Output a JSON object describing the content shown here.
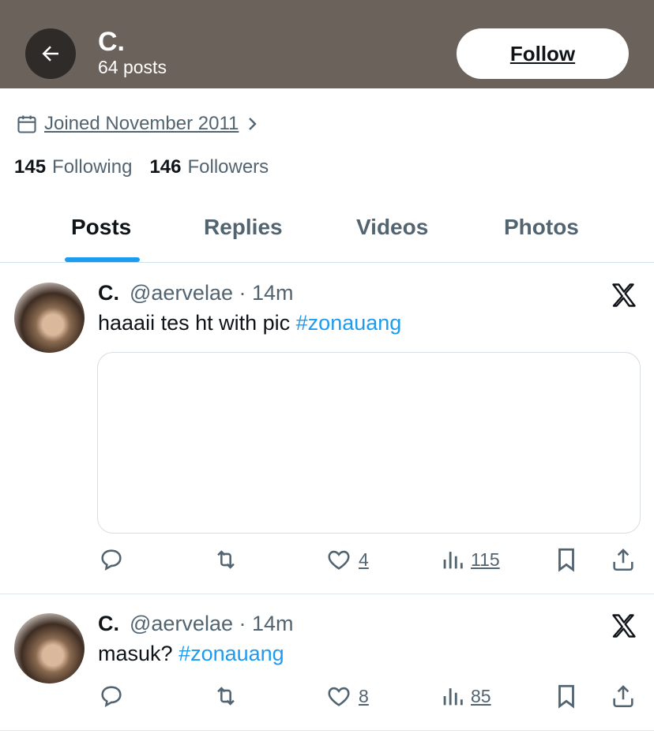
{
  "header": {
    "name": "C.",
    "posts_count": "64 posts",
    "follow_label": "Follow"
  },
  "profile": {
    "joined": "Joined November 2011",
    "following_count": "145",
    "following_label": "Following",
    "followers_count": "146",
    "followers_label": "Followers"
  },
  "tabs": [
    {
      "label": "Posts",
      "active": true
    },
    {
      "label": "Replies",
      "active": false
    },
    {
      "label": "Videos",
      "active": false
    },
    {
      "label": "Photos",
      "active": false
    }
  ],
  "posts": [
    {
      "name": "C.",
      "handle": "@aervelae",
      "time": "· 14m",
      "text": "haaaii tes ht with pic",
      "hashtag": "#zonauang",
      "likes": "4",
      "views": "115",
      "has_media": true
    },
    {
      "name": "C.",
      "handle": "@aervelae",
      "time": "· 14m",
      "text": "masuk?",
      "hashtag": "#zonauang",
      "likes": "8",
      "views": "85",
      "has_media": false
    }
  ],
  "icons": [
    "back-arrow-icon",
    "calendar-icon",
    "chevron-right-icon",
    "x-logo-icon",
    "reply-icon",
    "repost-icon",
    "like-icon",
    "views-icon",
    "bookmark-icon",
    "share-icon"
  ],
  "colors": {
    "header_bg": "#6b625b",
    "accent": "#1d9bf0",
    "secondary_text": "#536471"
  }
}
